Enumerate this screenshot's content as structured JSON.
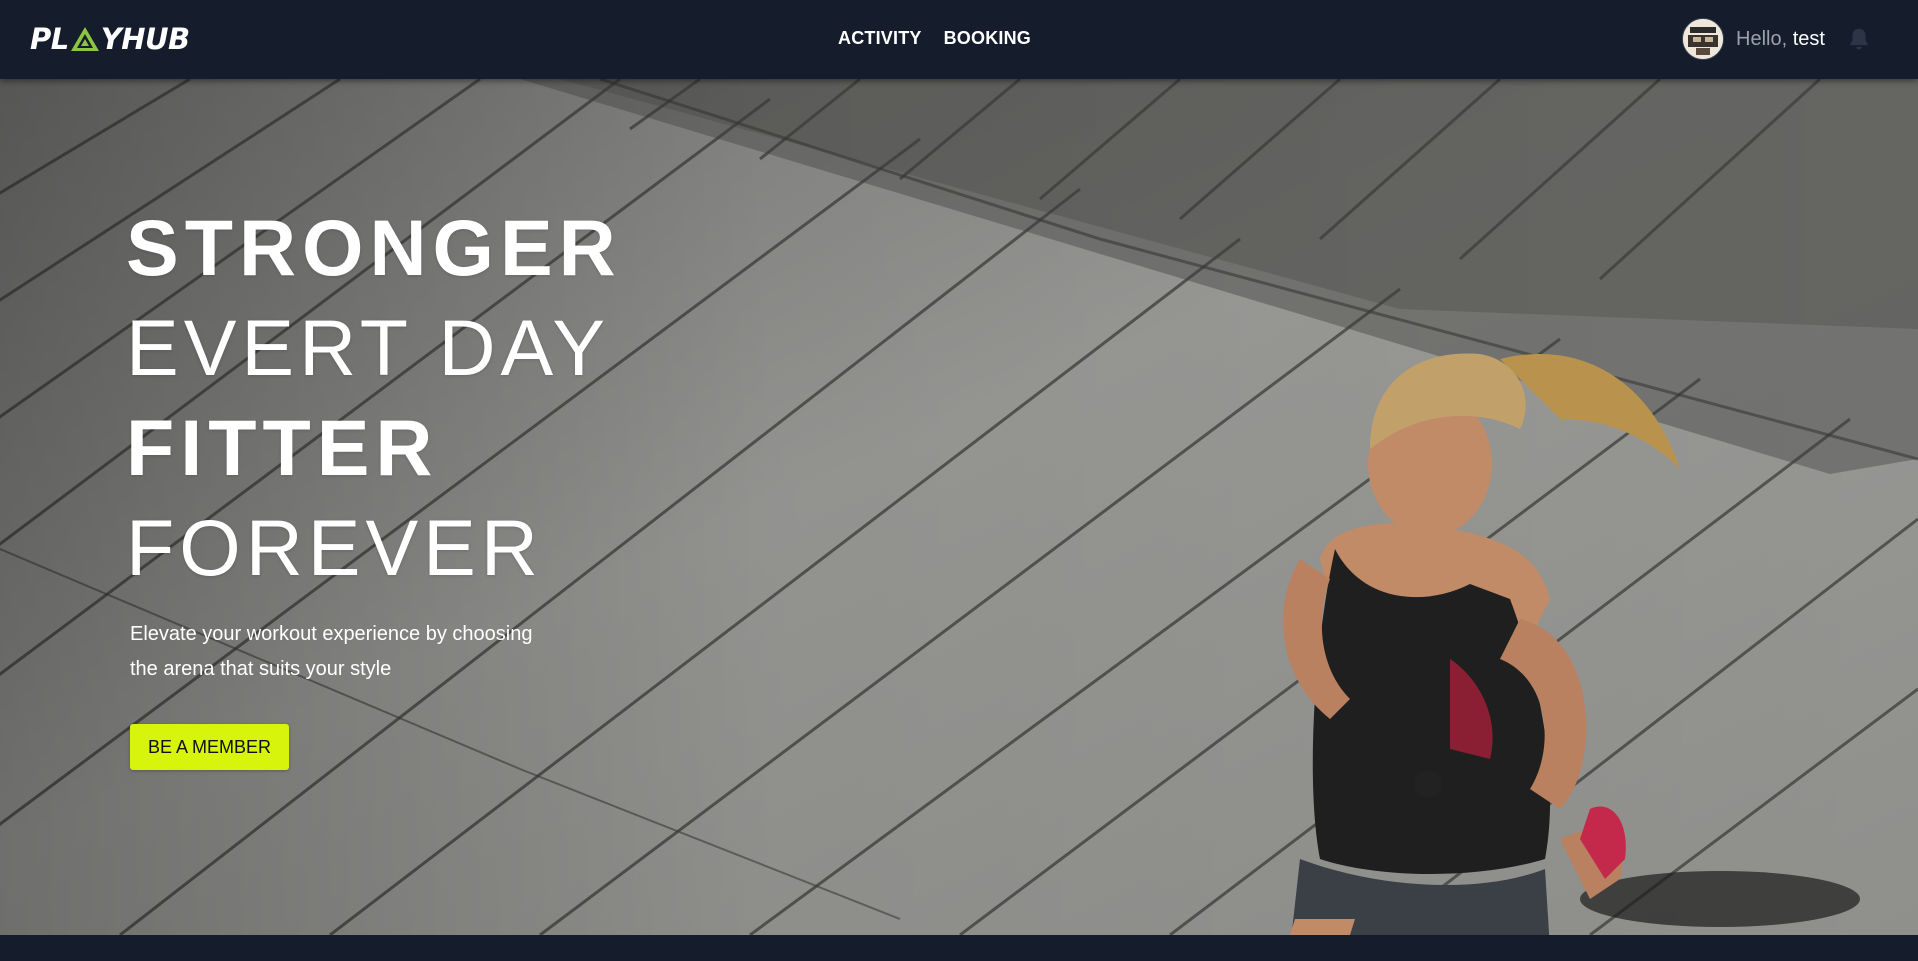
{
  "brand": {
    "logo_prefix": "PL",
    "logo_suffix": "YHUB",
    "accent_color": "#d7f40c",
    "navbar_color": "#151c2c"
  },
  "nav": {
    "links": [
      {
        "label": "ACTIVITY"
      },
      {
        "label": "BOOKING"
      }
    ]
  },
  "user": {
    "greeting_prefix": "Hello,",
    "name": "test",
    "avatar_icon": "avatar-image",
    "notification_icon": "bell-icon"
  },
  "hero": {
    "headline": {
      "line1": "STRONGER",
      "line2": "EVERT DAY",
      "line3": "FITTER",
      "line4": "FOREVER"
    },
    "subtitle_line1": "Elevate your workout experience by choosing",
    "subtitle_line2": "the arena that suits your style",
    "cta_label": "BE A MEMBER"
  }
}
